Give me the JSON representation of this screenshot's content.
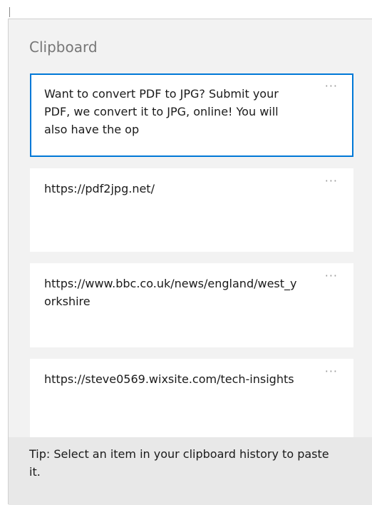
{
  "clipboard": {
    "title": "Clipboard",
    "more_glyph": "···",
    "items": [
      {
        "text": "Want to convert PDF to JPG? Submit your PDF, we convert it to JPG, online! You will also have the op",
        "selected": true
      },
      {
        "text": "https://pdf2jpg.net/",
        "selected": false
      },
      {
        "text": "https://www.bbc.co.uk/news/england/west_yorkshire",
        "selected": false
      },
      {
        "text": "https://steve0569.wixsite.com/tech-insights",
        "selected": false
      }
    ],
    "tip": "Tip: Select an item in your clipboard history to paste it."
  },
  "colors": {
    "panel_bg": "#f2f2f2",
    "item_bg": "#ffffff",
    "selected_border": "#0078d7",
    "tip_bg": "#e8e8e8"
  }
}
